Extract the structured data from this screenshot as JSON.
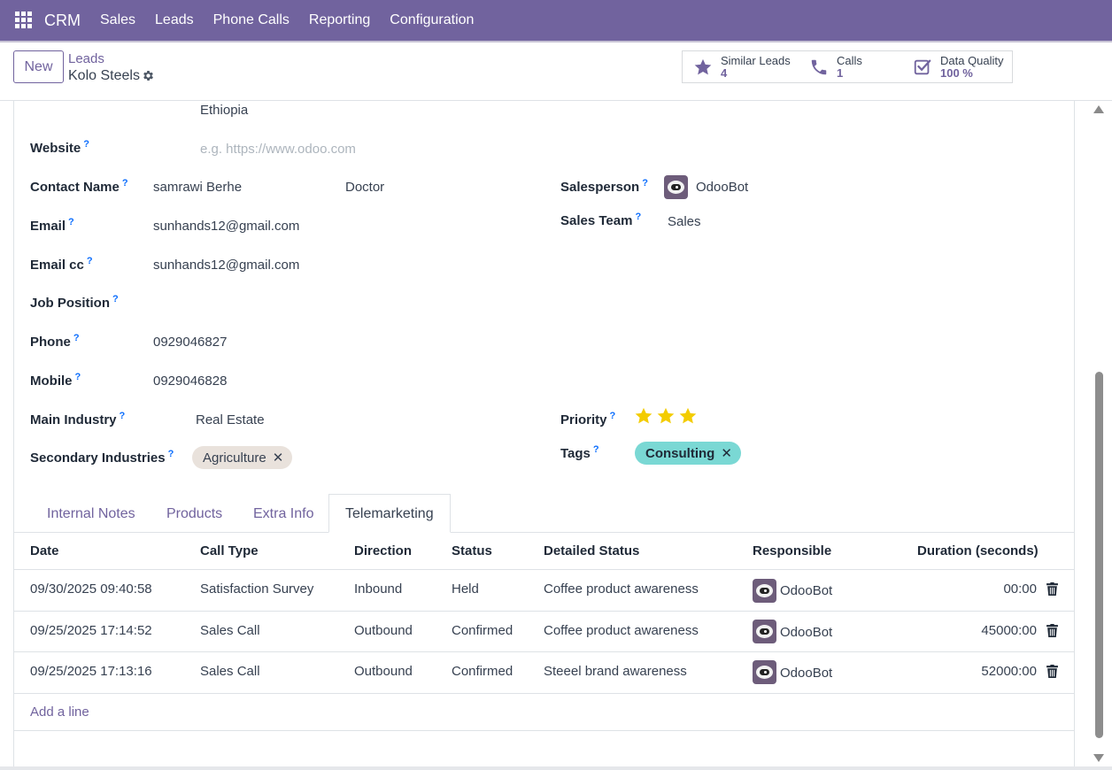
{
  "topbar": {
    "brand": "CRM",
    "menu": [
      "Sales",
      "Leads",
      "Phone Calls",
      "Reporting",
      "Configuration"
    ],
    "bg_color": "#71639e"
  },
  "control": {
    "new_label": "New",
    "breadcrumb_parent": "Leads",
    "breadcrumb_current": "Kolo Steels",
    "smart_buttons": [
      {
        "label": "Similar Leads",
        "value": "4",
        "icon": "star-icon"
      },
      {
        "label": "Calls",
        "value": "1",
        "icon": "phone-icon"
      },
      {
        "label": "Data Quality",
        "value": "100 %",
        "icon": "checkbox-icon"
      }
    ]
  },
  "form": {
    "country": "Ethiopia",
    "website_label": "Website",
    "website_placeholder": "e.g. https://www.odoo.com",
    "contact_name_label": "Contact Name",
    "contact_name": "samrawi Berhe",
    "contact_title": "Doctor",
    "email_label": "Email",
    "email": "sunhands12@gmail.com",
    "email_cc_label": "Email cc",
    "email_cc": "sunhands12@gmail.com",
    "job_position_label": "Job Position",
    "phone_label": "Phone",
    "phone": "0929046827",
    "mobile_label": "Mobile",
    "mobile": "0929046828",
    "main_industry_label": "Main Industry",
    "main_industry": "Real Estate",
    "secondary_industries_label": "Secondary Industries",
    "secondary_industries": [
      "Agriculture"
    ],
    "salesperson_label": "Salesperson",
    "salesperson": "OdooBot",
    "sales_team_label": "Sales Team",
    "sales_team": "Sales",
    "priority_label": "Priority",
    "priority_stars": 3,
    "tags_label": "Tags",
    "tags": [
      "Consulting"
    ],
    "help_mark": "?"
  },
  "tabs": [
    "Internal Notes",
    "Products",
    "Extra Info",
    "Telemarketing"
  ],
  "active_tab": "Telemarketing",
  "calls_table": {
    "headers": [
      "Date",
      "Call Type",
      "Direction",
      "Status",
      "Detailed Status",
      "Responsible",
      "Duration (seconds)"
    ],
    "rows": [
      {
        "date": "09/30/2025 09:40:58",
        "call_type": "Satisfaction Survey",
        "direction": "Inbound",
        "status": "Held",
        "detailed_status": "Coffee product awareness",
        "responsible": "OdooBot",
        "duration": "00:00"
      },
      {
        "date": "09/25/2025 17:14:52",
        "call_type": "Sales Call",
        "direction": "Outbound",
        "status": "Confirmed",
        "detailed_status": "Coffee product awareness",
        "responsible": "OdooBot",
        "duration": "45000:00"
      },
      {
        "date": "09/25/2025 17:13:16",
        "call_type": "Sales Call",
        "direction": "Outbound",
        "status": "Confirmed",
        "detailed_status": "Steeel brand awareness",
        "responsible": "OdooBot",
        "duration": "52000:00"
      }
    ],
    "add_line": "Add a line"
  },
  "colors": {
    "accent": "#71639e",
    "star": "#f3cc00",
    "tag_agriculture_bg": "#e9e2dc",
    "tag_consulting_bg": "#7ad8d4",
    "help": "#0d6efd"
  }
}
